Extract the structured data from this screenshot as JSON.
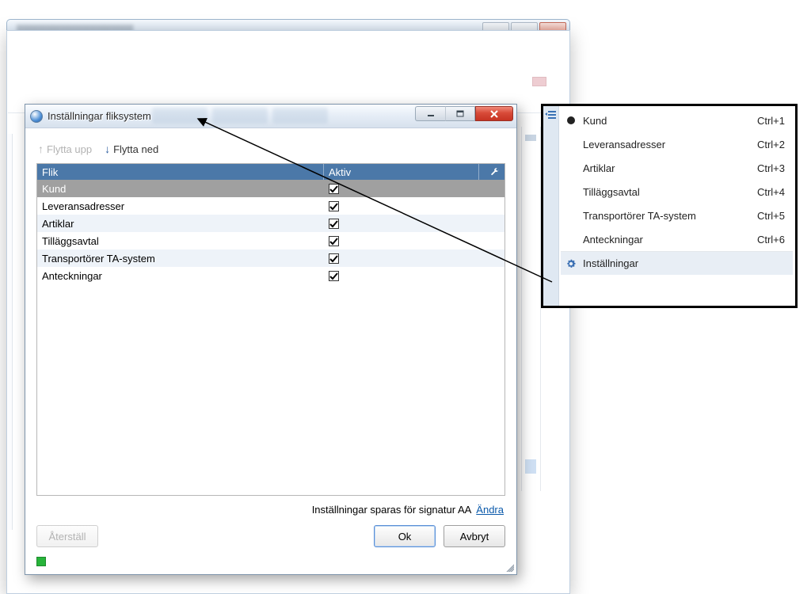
{
  "dialog": {
    "title": "Inställningar fliksystem",
    "toolbar": {
      "move_up": "Flytta upp",
      "move_down": "Flytta ned"
    },
    "columns": {
      "flik": "Flik",
      "aktiv": "Aktiv"
    },
    "rows": [
      {
        "name": "Kund",
        "active": true,
        "selected": true
      },
      {
        "name": "Leveransadresser",
        "active": true,
        "selected": false
      },
      {
        "name": "Artiklar",
        "active": true,
        "selected": false
      },
      {
        "name": "Tilläggsavtal",
        "active": true,
        "selected": false
      },
      {
        "name": "Transportörer TA-system",
        "active": true,
        "selected": false
      },
      {
        "name": "Anteckningar",
        "active": true,
        "selected": false
      }
    ],
    "save_info": "Inställningar sparas för signatur AA",
    "change_link": "Ändra",
    "reset_btn": "Återställ",
    "ok_btn": "Ok",
    "cancel_btn": "Avbryt"
  },
  "menu": {
    "items": [
      {
        "label": "Kund",
        "shortcut": "Ctrl+1",
        "bullet": true
      },
      {
        "label": "Leveransadresser",
        "shortcut": "Ctrl+2",
        "bullet": false
      },
      {
        "label": "Artiklar",
        "shortcut": "Ctrl+3",
        "bullet": false
      },
      {
        "label": "Tilläggsavtal",
        "shortcut": "Ctrl+4",
        "bullet": false
      },
      {
        "label": "Transportörer TA-system",
        "shortcut": "Ctrl+5",
        "bullet": false
      },
      {
        "label": "Anteckningar",
        "shortcut": "Ctrl+6",
        "bullet": false
      }
    ],
    "settings_label": "Inställningar"
  }
}
